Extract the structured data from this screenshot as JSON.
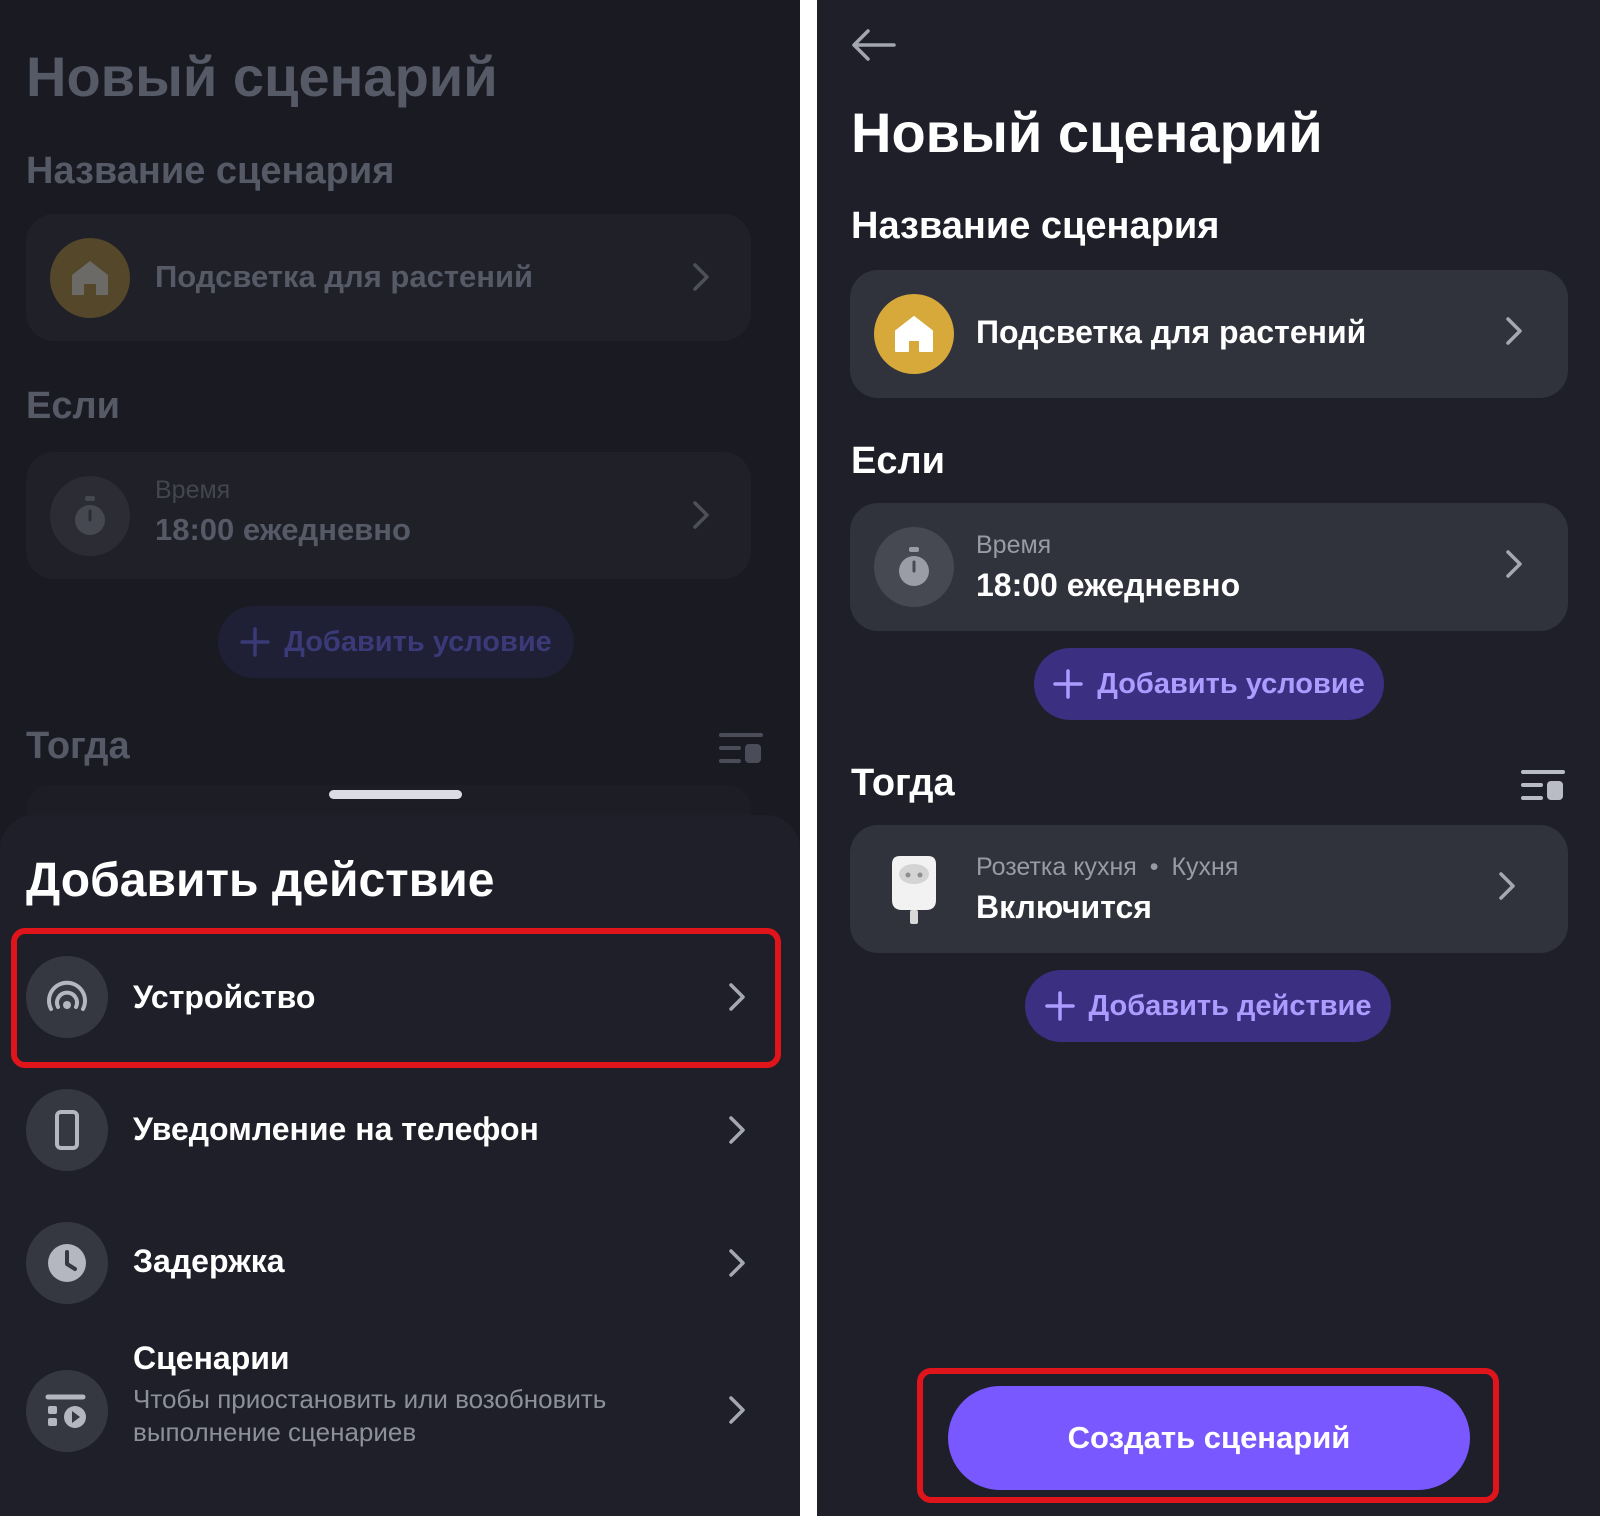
{
  "left": {
    "background": {
      "title": "Новый сценарий",
      "name_section_label": "Название сценария",
      "name_card_value": "Подсветка для растений",
      "if_label": "Если",
      "time_card_caption": "Время",
      "time_card_value": "18:00 ежедневно",
      "add_condition_label": "Добавить условие",
      "then_label": "Тогда"
    },
    "sheet": {
      "title": "Добавить действие",
      "items": [
        {
          "label": "Устройство",
          "icon": "smart-home-device-icon"
        },
        {
          "label": "Уведомление на телефон",
          "icon": "phone-icon"
        },
        {
          "label": "Задержка",
          "icon": "clock-icon"
        },
        {
          "label": "Сценарии",
          "subtitle": "Чтобы приостановить или возобновить выполнение сценариев",
          "icon": "scenarios-icon"
        }
      ]
    }
  },
  "right": {
    "title": "Новый сценарий",
    "name_section_label": "Название сценария",
    "name_card": {
      "value": "Подсветка для растений",
      "icon": "home-icon"
    },
    "if_label": "Если",
    "condition_card": {
      "caption": "Время",
      "value": "18:00 ежедневно",
      "icon": "stopwatch-icon"
    },
    "add_condition_label": "Добавить условие",
    "then_label": "Тогда",
    "action_card": {
      "device": "Розетка кухня",
      "separator": "•",
      "room": "Кухня",
      "state": "Включится",
      "icon": "smart-plug-icon"
    },
    "add_action_label": "Добавить действие",
    "create_button_label": "Создать сценарий"
  },
  "colors": {
    "accent": "#7a58ff",
    "pill_bg": "#3b2f82",
    "pill_text": "#ad9cff",
    "highlight": "#e0141b",
    "home_icon_bg": "#d6a93a"
  }
}
